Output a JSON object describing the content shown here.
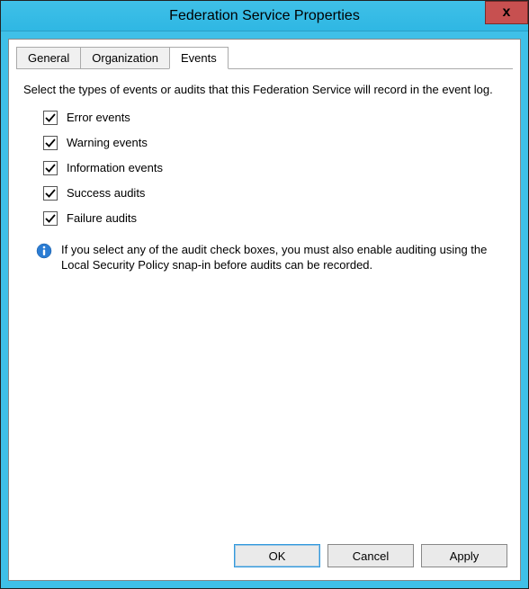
{
  "window": {
    "title": "Federation Service Properties",
    "close_label": "x"
  },
  "tabs": {
    "items": [
      {
        "label": "General",
        "active": false
      },
      {
        "label": "Organization",
        "active": false
      },
      {
        "label": "Events",
        "active": true
      }
    ]
  },
  "events_tab": {
    "intro": "Select the types of events or audits that this Federation Service will record in the event log.",
    "checkboxes": [
      {
        "label": "Error events",
        "checked": true
      },
      {
        "label": "Warning events",
        "checked": true
      },
      {
        "label": "Information events",
        "checked": true
      },
      {
        "label": "Success audits",
        "checked": true
      },
      {
        "label": "Failure audits",
        "checked": true
      }
    ],
    "info_text": "If you select any of the audit check boxes, you must also enable auditing using the Local Security Policy snap-in before audits can be recorded."
  },
  "buttons": {
    "ok": "OK",
    "cancel": "Cancel",
    "apply": "Apply"
  }
}
